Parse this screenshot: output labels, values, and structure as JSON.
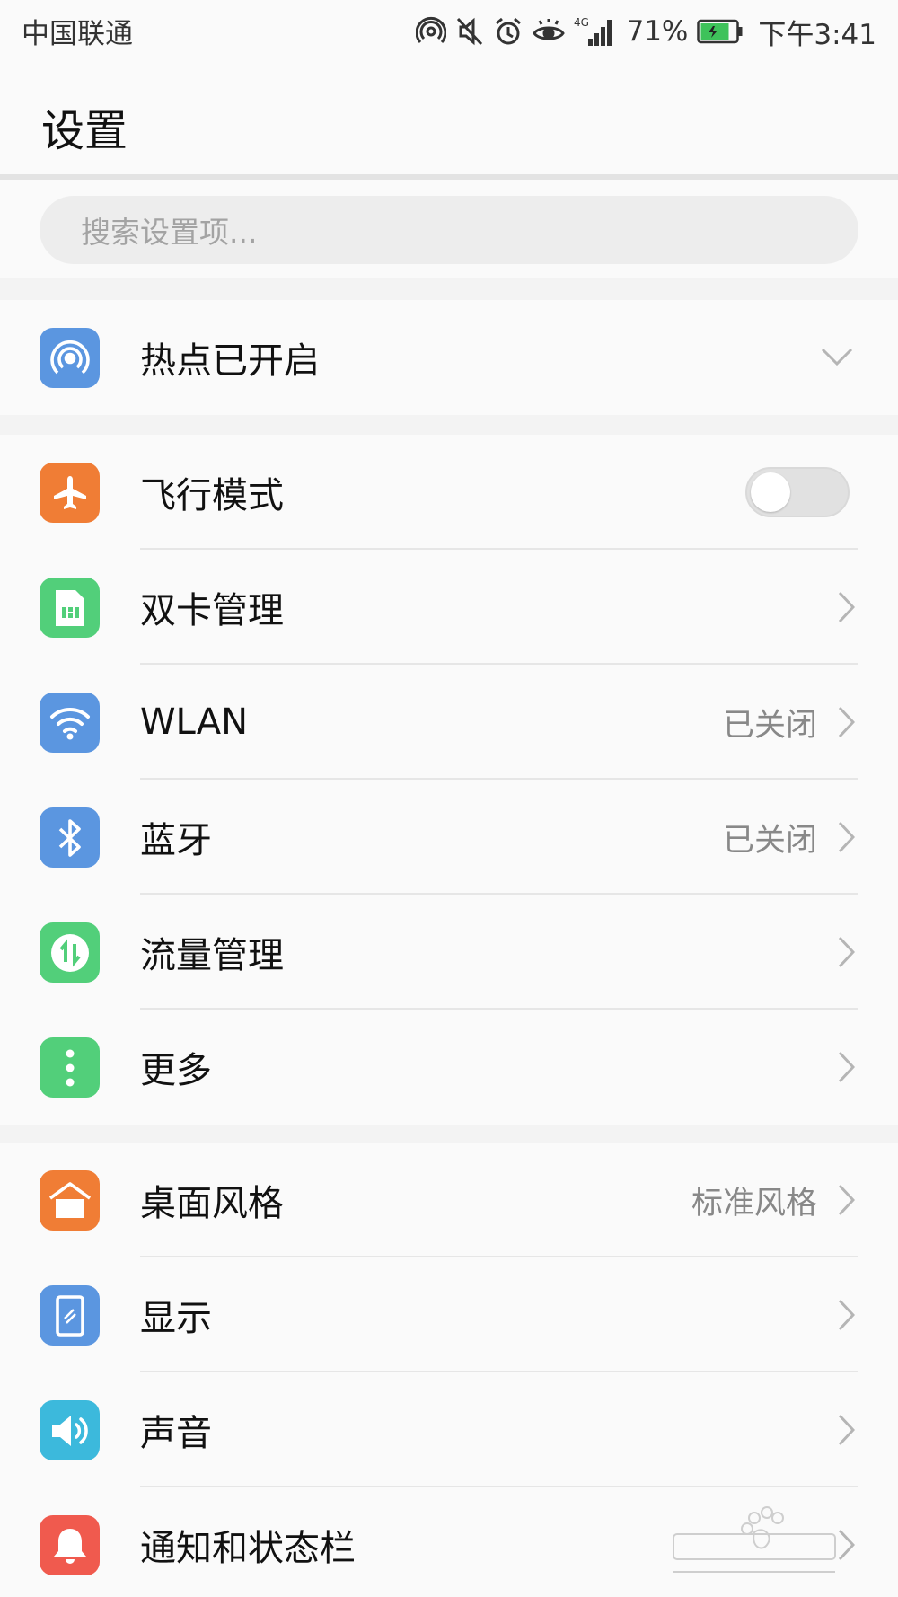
{
  "status_bar": {
    "carrier": "中国联通",
    "network": "4G",
    "battery_percent": "71%",
    "time": "下午3:41",
    "icons": [
      "hotspot-icon",
      "mute-icon",
      "alarm-icon",
      "eye-icon",
      "signal-icon",
      "battery-charging-icon"
    ]
  },
  "header": {
    "title": "设置"
  },
  "search": {
    "placeholder": "搜索设置项..."
  },
  "hotspot_row": {
    "label": "热点已开启",
    "icon": "hotspot-icon",
    "color": "#5b96e0"
  },
  "network_group": [
    {
      "label": "飞行模式",
      "icon": "airplane-icon",
      "color": "#f07d35",
      "toggle": false
    },
    {
      "label": "双卡管理",
      "icon": "sim-card-icon",
      "color": "#52cf7a",
      "value": ""
    },
    {
      "label": "WLAN",
      "icon": "wifi-icon",
      "color": "#5b96e0",
      "value": "已关闭"
    },
    {
      "label": "蓝牙",
      "icon": "bluetooth-icon",
      "color": "#5b96e0",
      "value": "已关闭"
    },
    {
      "label": "流量管理",
      "icon": "data-usage-icon",
      "color": "#52cf7a",
      "value": ""
    },
    {
      "label": "更多",
      "icon": "more-icon",
      "color": "#52cf7a",
      "value": ""
    }
  ],
  "display_group": [
    {
      "label": "桌面风格",
      "icon": "home-icon",
      "color": "#f07d35",
      "value": "标准风格"
    },
    {
      "label": "显示",
      "icon": "display-icon",
      "color": "#5b96e0",
      "value": ""
    },
    {
      "label": "声音",
      "icon": "sound-icon",
      "color": "#3cb9dc",
      "value": ""
    },
    {
      "label": "通知和状态栏",
      "icon": "bell-icon",
      "color": "#f05a4e",
      "value": ""
    }
  ]
}
